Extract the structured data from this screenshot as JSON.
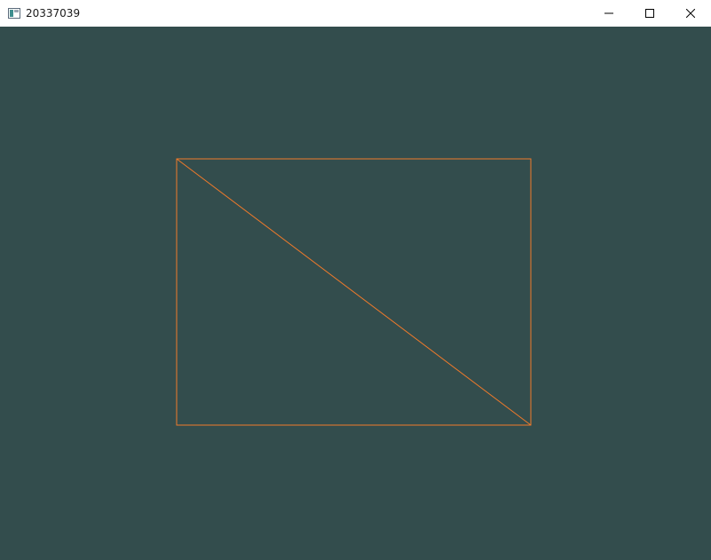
{
  "window": {
    "title": "20337039",
    "icon": "window-app-icon",
    "controls": {
      "minimize_icon": "minimize-icon",
      "maximize_icon": "maximize-icon",
      "close_icon": "close-icon"
    }
  },
  "viewport": {
    "background_color": "#334d4d",
    "stroke_color": "#f07a2a"
  }
}
